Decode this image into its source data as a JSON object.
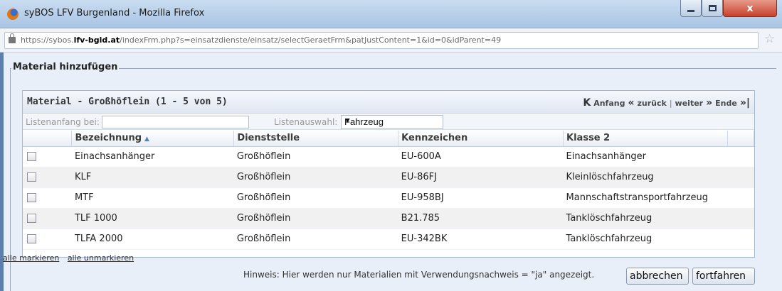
{
  "window": {
    "title": "syBOS LFV Burgenland - Mozilla Firefox",
    "url_prefix": "https://sybos.",
    "url_domain": "lfv-bgld.at",
    "url_path": "/indexFrm.php?s=einsatzdienste/einsatz/selectGeraetFrm&patJustContent=1&id=0&idParent=49",
    "close_symbol": "x"
  },
  "dialog": {
    "legend": "Material hinzufügen",
    "panel_title": "Material - Großhöflein (1 - 5 von 5)",
    "pager": {
      "first": "Anfang",
      "prev": "zurück",
      "separator": "|",
      "next": "weiter",
      "last": "Ende"
    },
    "filter": {
      "start_label": "Listenanfang bei:",
      "start_value": "",
      "select_label": "Listenauswahl:",
      "select_value": "Fahrzeug"
    },
    "columns": [
      "Bezeichnung",
      "Dienststelle",
      "Kennzeichen",
      "Klasse 2"
    ],
    "rows": [
      {
        "bezeichnung": "Einachsanhänger",
        "dienststelle": "Großhöflein",
        "kennzeichen": "EU-600A",
        "klasse": "Einachsanhänger",
        "checked": false
      },
      {
        "bezeichnung": "KLF",
        "dienststelle": "Großhöflein",
        "kennzeichen": "EU-86FJ",
        "klasse": "Kleinlöschfahrzeug",
        "checked": false
      },
      {
        "bezeichnung": "MTF",
        "dienststelle": "Großhöflein",
        "kennzeichen": "EU-958BJ",
        "klasse": "Mannschaftstransportfahrzeug",
        "checked": false
      },
      {
        "bezeichnung": "TLF 1000",
        "dienststelle": "Großhöflein",
        "kennzeichen": "B21.785",
        "klasse": "Tanklöschfahrzeug",
        "checked": false
      },
      {
        "bezeichnung": "TLFA 2000",
        "dienststelle": "Großhöflein",
        "kennzeichen": "EU-342BK",
        "klasse": "Tanklöschfahrzeug",
        "checked": false
      }
    ],
    "mark_all": "alle markieren",
    "unmark_all": "alle unmarkieren",
    "hint": "Hinweis: Hier werden nur Materialien mit Verwendungsnachweis = \"ja\" angezeigt.",
    "cancel_label": "abbrechen",
    "continue_label": "fortfahren"
  }
}
